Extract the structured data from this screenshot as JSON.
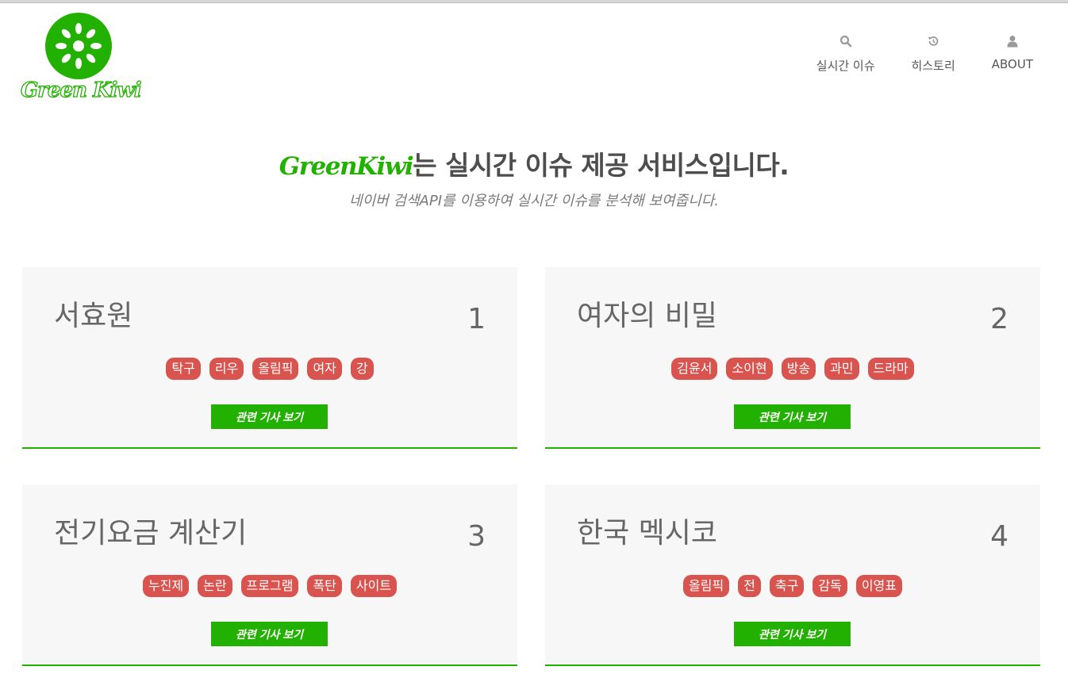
{
  "brand": {
    "logo_text": "Green Kiwi",
    "accent_color": "#22b100",
    "tag_color": "#d9534f"
  },
  "nav": [
    {
      "icon": "search-icon",
      "label": "실시간 이슈"
    },
    {
      "icon": "history-icon",
      "label": "히스토리"
    },
    {
      "icon": "user-icon",
      "label": "ABOUT"
    }
  ],
  "hero": {
    "brand_word": "GreenKiwi",
    "title_rest": "는 실시간 이슈 제공 서비스입니다.",
    "subtitle": "네이버 검색API를 이용하여 실시간 이슈를 분석해 보여줍니다."
  },
  "issues": [
    {
      "title": "서효원",
      "rank": "1",
      "tags": [
        "탁구",
        "리우",
        "올림픽",
        "여자",
        "강"
      ],
      "button_label": "관련 기사 보기"
    },
    {
      "title": "여자의 비밀",
      "rank": "2",
      "tags": [
        "김윤서",
        "소이현",
        "방송",
        "과민",
        "드라마"
      ],
      "button_label": "관련 기사 보기"
    },
    {
      "title": "전기요금 계산기",
      "rank": "3",
      "tags": [
        "누진제",
        "논란",
        "프로그램",
        "폭탄",
        "사이트"
      ],
      "button_label": "관련 기사 보기"
    },
    {
      "title": "한국 멕시코",
      "rank": "4",
      "tags": [
        "올림픽",
        "전",
        "축구",
        "감독",
        "이영표"
      ],
      "button_label": "관련 기사 보기"
    }
  ]
}
